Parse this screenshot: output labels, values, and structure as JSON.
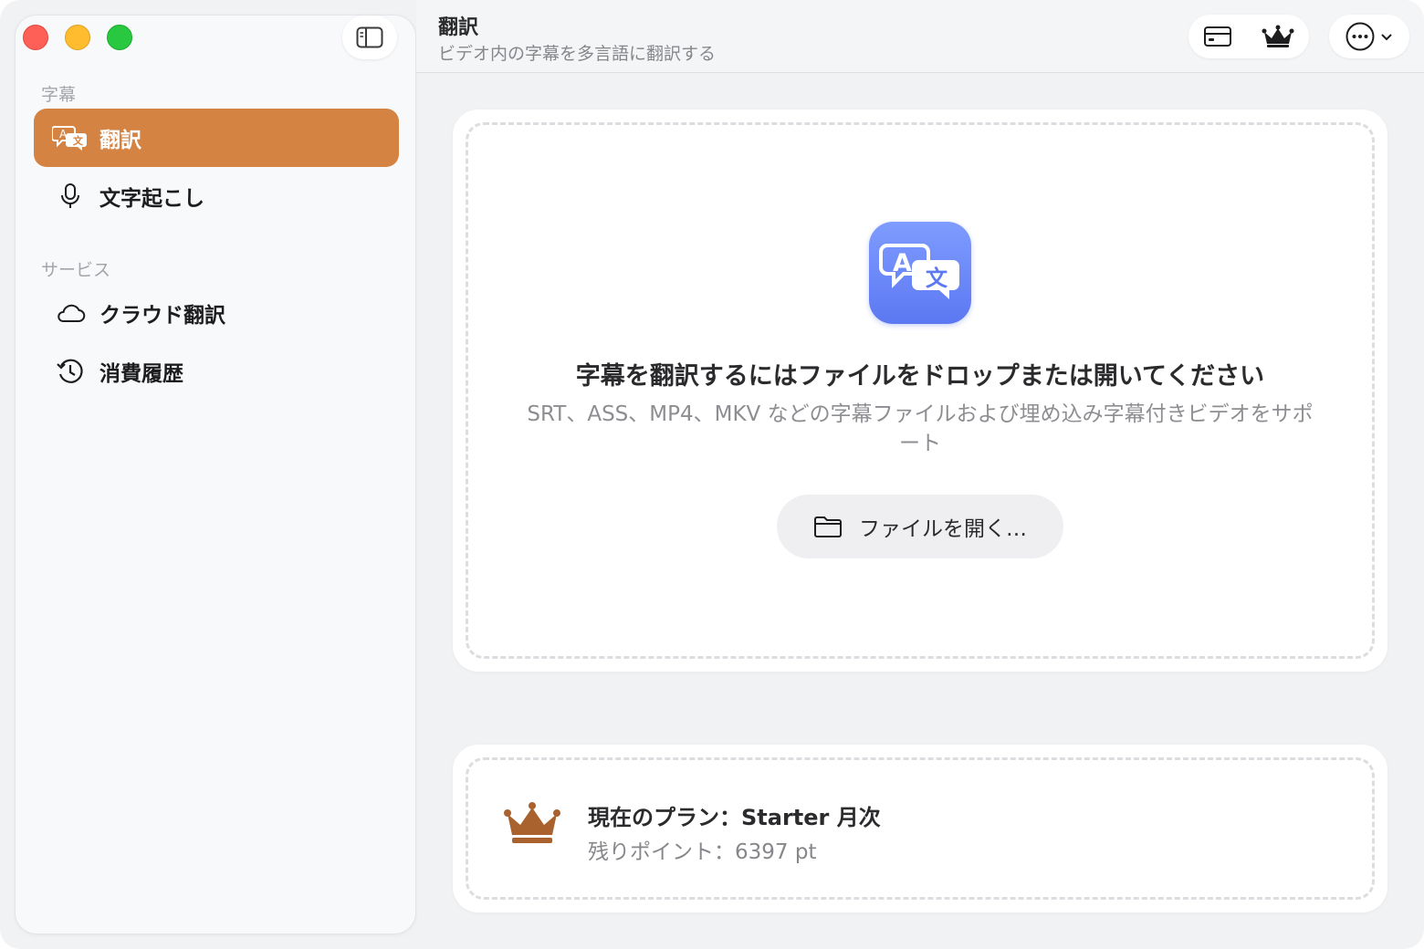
{
  "sidebar": {
    "sections": [
      {
        "label": "字幕",
        "items": [
          {
            "label": "翻訳",
            "icon": "translate-icon",
            "active": true
          },
          {
            "label": "文字起こし",
            "icon": "microphone-icon",
            "active": false
          }
        ]
      },
      {
        "label": "サービス",
        "items": [
          {
            "label": "クラウド翻訳",
            "icon": "cloud-icon",
            "active": false
          },
          {
            "label": "消費履歴",
            "icon": "history-icon",
            "active": false
          }
        ]
      }
    ]
  },
  "header": {
    "title": "翻訳",
    "subtitle": "ビデオ内の字幕を多言語に翻訳する",
    "buttons": [
      "card-icon",
      "crown-icon",
      "more-icon"
    ]
  },
  "drop_zone": {
    "title": "字幕を翻訳するにはファイルをドロップまたは開いてください",
    "subtitle": "SRT、ASS、MP4、MKV などの字幕ファイルおよび埋め込み字幕付きビデオをサポート",
    "open_button": "ファイルを開く…"
  },
  "plan": {
    "title": "現在のプラン：Starter 月次",
    "points": "残りポイント：6397 pt"
  },
  "colors": {
    "accent": "#d58342",
    "app_icon": "#6b88fb",
    "crown": "#a9622d"
  }
}
